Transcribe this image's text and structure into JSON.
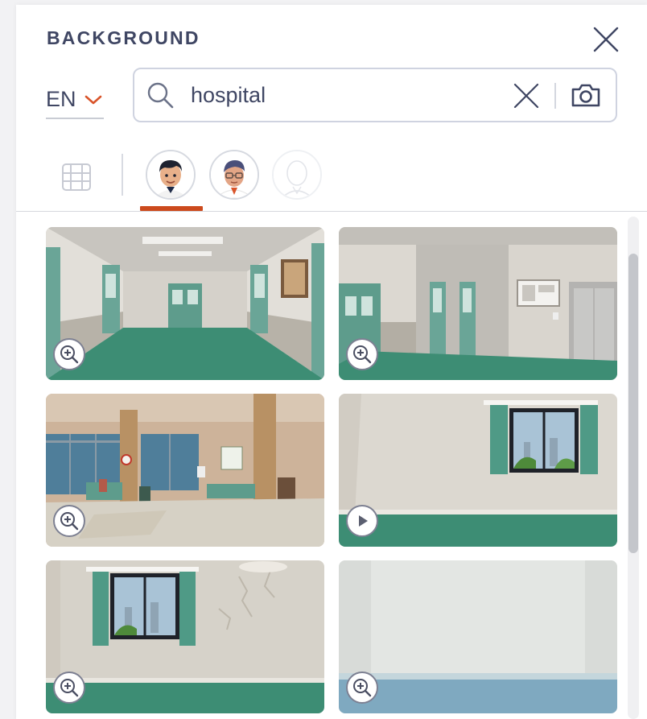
{
  "panel": {
    "title": "BACKGROUND",
    "close_icon": "close-icon"
  },
  "language": {
    "selected": "EN",
    "icon": "chevron-down-icon",
    "accent_color": "#d9542a"
  },
  "search": {
    "value": "hospital",
    "icons": [
      "search-icon",
      "clear-icon",
      "camera-icon"
    ]
  },
  "filters": {
    "items": [
      {
        "name": "grid-icon",
        "active": false
      },
      {
        "name": "avatar-young-man",
        "active": true
      },
      {
        "name": "avatar-man-glasses",
        "active": false
      },
      {
        "name": "avatar-blank",
        "active": false
      }
    ],
    "active_color": "#cc4a1d"
  },
  "results": {
    "items": [
      {
        "name": "hospital-corridor",
        "badge": "zoom-in-icon"
      },
      {
        "name": "hospital-hallway-elevator",
        "badge": "zoom-in-icon"
      },
      {
        "name": "hospital-waiting-room",
        "badge": "zoom-in-icon"
      },
      {
        "name": "hospital-room-window",
        "badge": "play-icon"
      },
      {
        "name": "hospital-room-window-cracked",
        "badge": "zoom-in-icon"
      },
      {
        "name": "empty-room-blue-floor",
        "badge": "zoom-in-icon"
      }
    ]
  },
  "colors": {
    "title_text": "#3f4663",
    "hospital_green": "#3f8f78",
    "wall": "#dcd7cf"
  }
}
